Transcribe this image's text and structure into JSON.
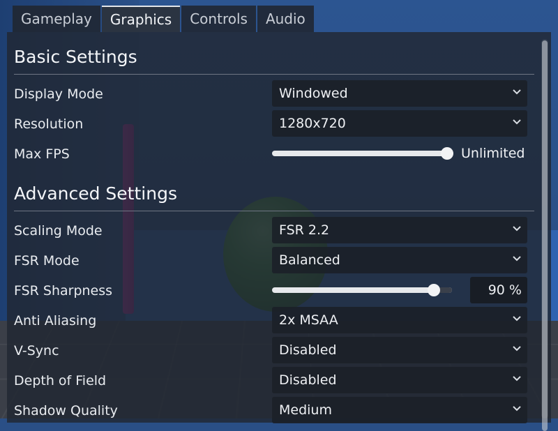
{
  "tabs": [
    "Gameplay",
    "Graphics",
    "Controls",
    "Audio"
  ],
  "active_tab": "Graphics",
  "basic": {
    "title": "Basic Settings",
    "display_mode": {
      "label": "Display Mode",
      "value": "Windowed"
    },
    "resolution": {
      "label": "Resolution",
      "value": "1280x720"
    },
    "max_fps": {
      "label": "Max FPS",
      "value_text": "Unlimited",
      "slider_fraction": 1.0
    }
  },
  "advanced": {
    "title": "Advanced Settings",
    "scaling_mode": {
      "label": "Scaling Mode",
      "value": "FSR 2.2"
    },
    "fsr_mode": {
      "label": "FSR Mode",
      "value": "Balanced"
    },
    "fsr_sharpness": {
      "label": "FSR Sharpness",
      "value": "90 %",
      "slider_fraction": 0.9
    },
    "anti_aliasing": {
      "label": "Anti Aliasing",
      "value": "2x MSAA"
    },
    "vsync": {
      "label": "V-Sync",
      "value": "Disabled"
    },
    "depth_of_field": {
      "label": "Depth of Field",
      "value": "Disabled"
    },
    "shadow_quality": {
      "label": "Shadow Quality",
      "value": "Medium"
    }
  },
  "colors": {
    "accent": "#e3e6ea",
    "panel": "#212732",
    "sphere": "#3e8a3d",
    "pillar": "#b437a6"
  }
}
